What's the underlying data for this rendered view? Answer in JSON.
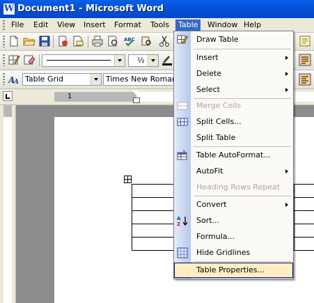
{
  "window": {
    "title": "Document1 - Microsoft Word"
  },
  "menubar": {
    "items": [
      {
        "label": "File"
      },
      {
        "label": "Edit"
      },
      {
        "label": "View"
      },
      {
        "label": "Insert"
      },
      {
        "label": "Format"
      },
      {
        "label": "Tools"
      },
      {
        "label": "Table"
      },
      {
        "label": "Window"
      },
      {
        "label": "Help"
      }
    ],
    "active": "Table"
  },
  "toolbar_format": {
    "line_weight": "½"
  },
  "toolbar_style": {
    "style": "Table Grid",
    "font": "Times New Roman"
  },
  "ruler": {
    "tick_label": "1"
  },
  "table_menu": {
    "items": [
      {
        "label": "Draw Table",
        "icon": "pencil-icon"
      },
      {
        "label": "Insert",
        "submenu": true
      },
      {
        "label": "Delete",
        "submenu": true
      },
      {
        "label": "Select",
        "submenu": true
      },
      {
        "label": "Merge Cells",
        "disabled": true,
        "icon": "merge-cells-icon"
      },
      {
        "label": "Split Cells...",
        "icon": "split-cells-icon"
      },
      {
        "label": "Split Table"
      },
      {
        "label": "Table AutoFormat...",
        "icon": "autoformat-icon"
      },
      {
        "label": "AutoFit",
        "submenu": true
      },
      {
        "label": "Heading Rows Repeat",
        "disabled": true
      },
      {
        "label": "Convert",
        "submenu": true
      },
      {
        "label": "Sort...",
        "icon": "sort-az-icon"
      },
      {
        "label": "Formula..."
      },
      {
        "label": "Hide Gridlines",
        "icon": "gridlines-icon"
      },
      {
        "label": "Table Properties...",
        "highlighted": true
      }
    ]
  },
  "colors": {
    "title_bar": "#0453d9",
    "menu_highlight": "#316ac5",
    "item_highlight": "#ffeec2"
  }
}
